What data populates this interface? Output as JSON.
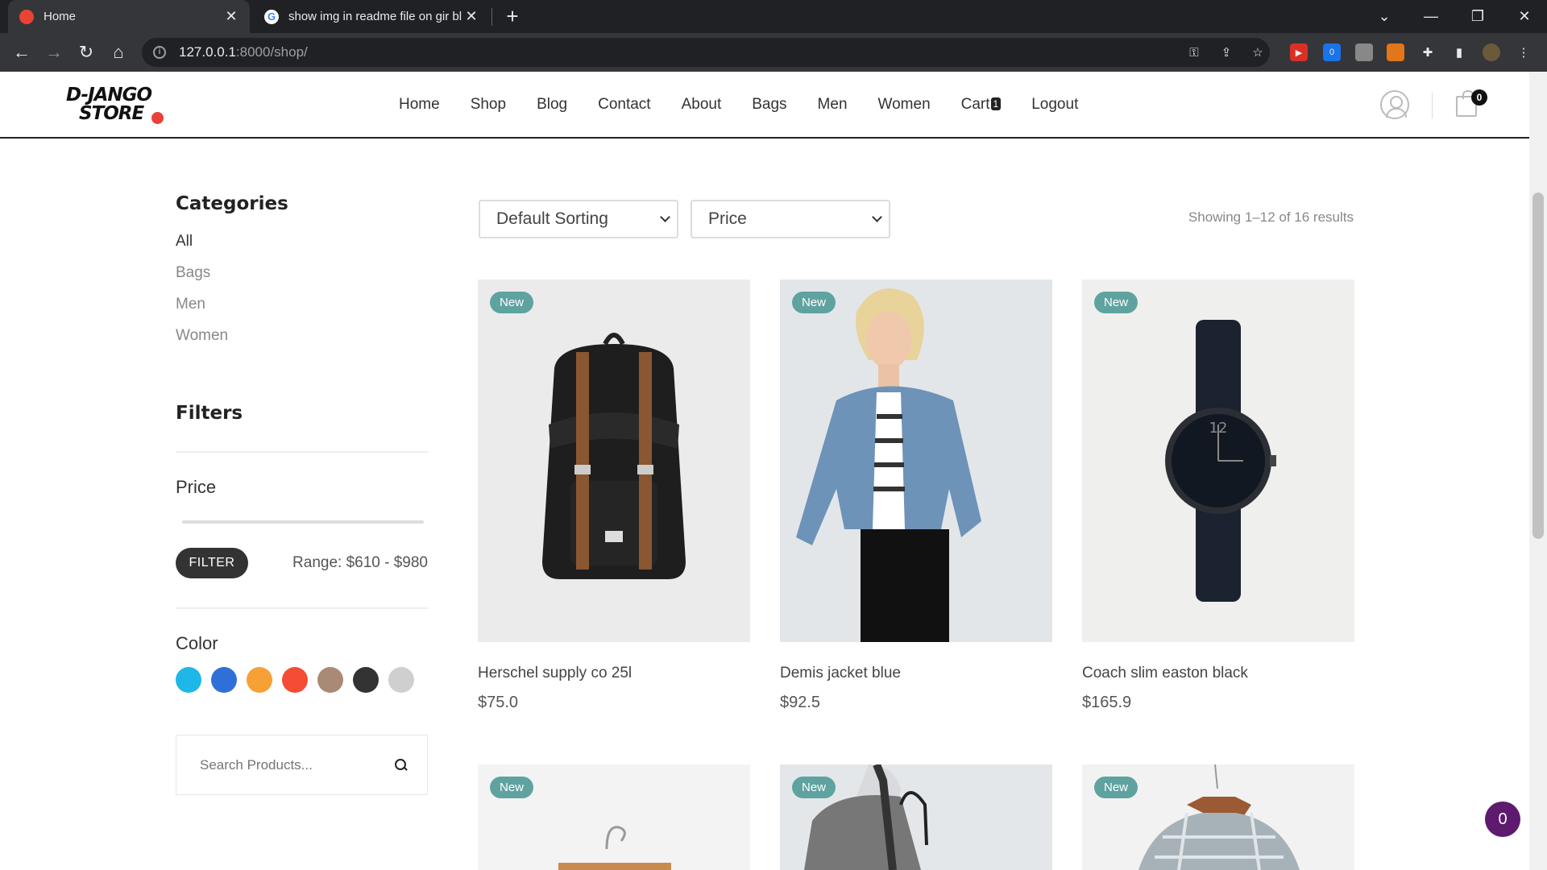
{
  "browser": {
    "tabs": [
      {
        "title": "Home",
        "active": true
      },
      {
        "title": "show img in readme file on gir bl",
        "active": false
      }
    ],
    "new_tab": "+",
    "url_host": "127.0.0.1",
    "url_path": ":8000/shop/",
    "extension_badge": "0"
  },
  "header": {
    "logo_line1": "D-JANGO",
    "logo_line2": "STORE",
    "nav": [
      "Home",
      "Shop",
      "Blog",
      "Contact",
      "About",
      "Bags",
      "Men",
      "Women",
      "Cart",
      "Logout"
    ],
    "cart_count": "1",
    "bag_count": "0"
  },
  "sidebar": {
    "categories_title": "Categories",
    "categories": [
      "All",
      "Bags",
      "Men",
      "Women"
    ],
    "filters_title": "Filters",
    "price_title": "Price",
    "filter_button": "FILTER",
    "range_text": "Range: $610 - $980",
    "color_title": "Color",
    "colors": [
      "#1fb6e8",
      "#2f6fd8",
      "#f7a035",
      "#f44d35",
      "#a88a76",
      "#333333",
      "#cfcfcf"
    ],
    "search_placeholder": "Search Products..."
  },
  "shop": {
    "sort_select": "Default Sorting",
    "price_select": "Price",
    "showing": "Showing 1–12 of 16 results",
    "badge": "New",
    "products": [
      {
        "name": "Herschel supply co 25l",
        "price": "$75.0"
      },
      {
        "name": "Demis jacket blue",
        "price": "$92.5"
      },
      {
        "name": "Coach slim easton black",
        "price": "$165.9"
      }
    ]
  },
  "chat_count": "0"
}
